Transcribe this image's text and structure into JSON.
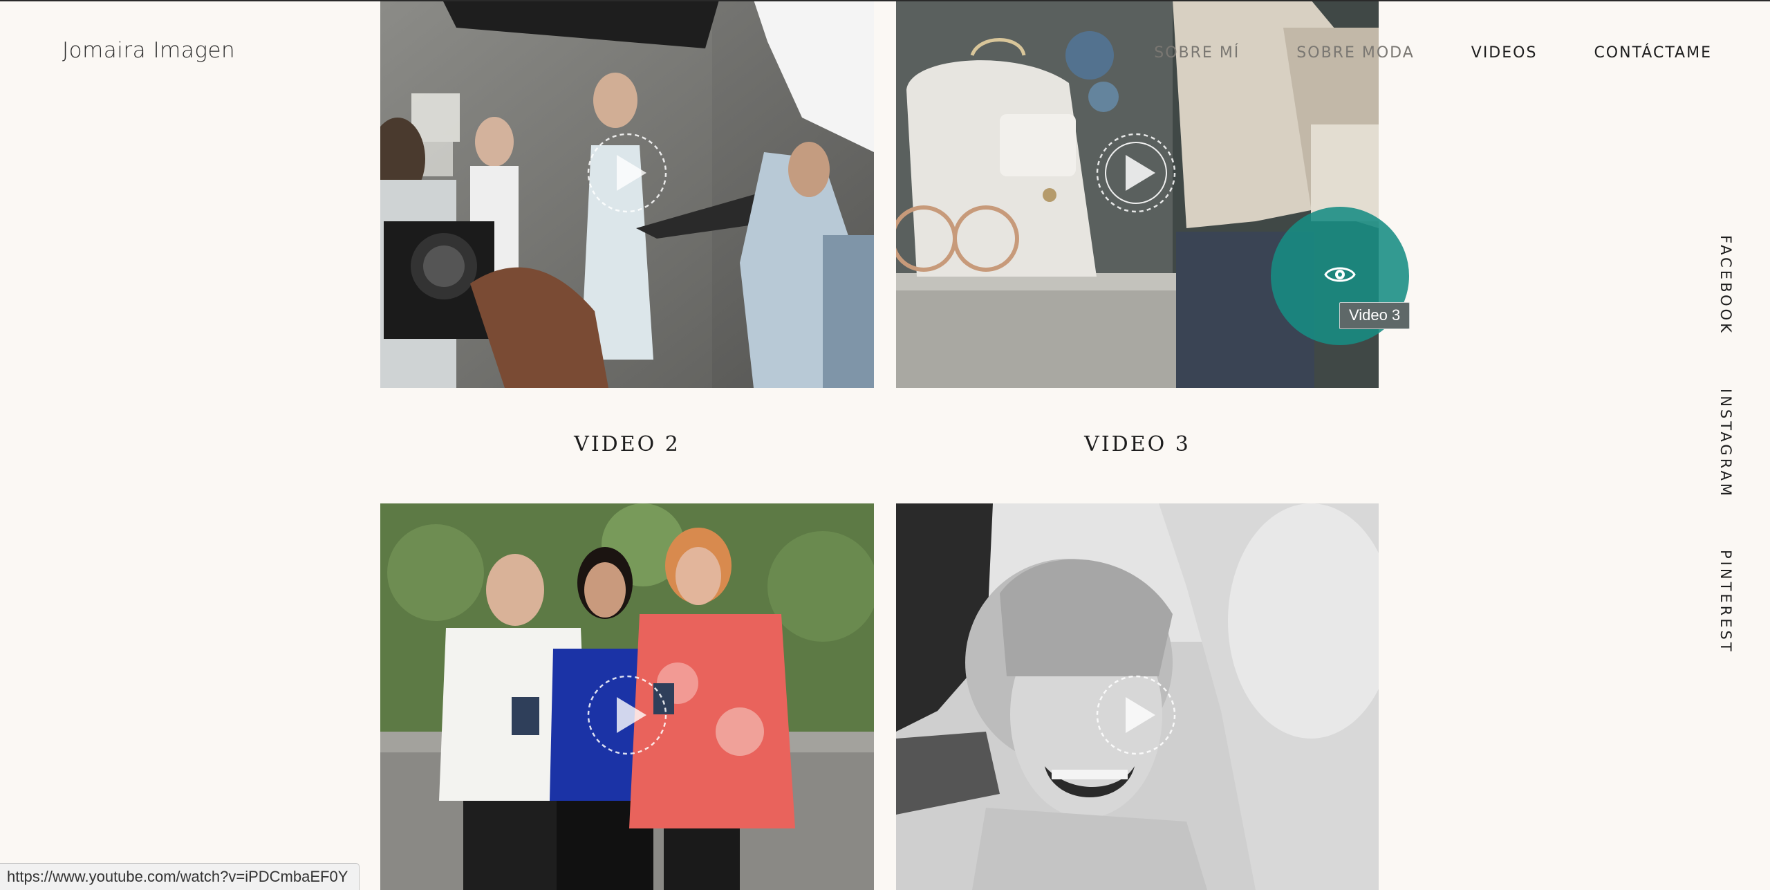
{
  "site": {
    "logo_text": "Jomaira Imagen"
  },
  "nav": {
    "items": [
      {
        "label": "SOBRE MÍ"
      },
      {
        "label": "SOBRE MODA"
      },
      {
        "label": "VIDEOS"
      },
      {
        "label": "CONTÁCTAME"
      }
    ]
  },
  "social": {
    "items": [
      {
        "label": "FACEBOOK"
      },
      {
        "label": "INSTAGRAM"
      },
      {
        "label": "PINTEREST"
      }
    ]
  },
  "videos": [
    {
      "title": "VIDEO 2"
    },
    {
      "title": "VIDEO 3"
    },
    {
      "title": ""
    },
    {
      "title": ""
    }
  ],
  "hover": {
    "tooltip": "Video 3",
    "accent_color": "#178c83"
  },
  "status_bar": {
    "url": "https://www.youtube.com/watch?v=iPDCmbaEF0Y"
  }
}
